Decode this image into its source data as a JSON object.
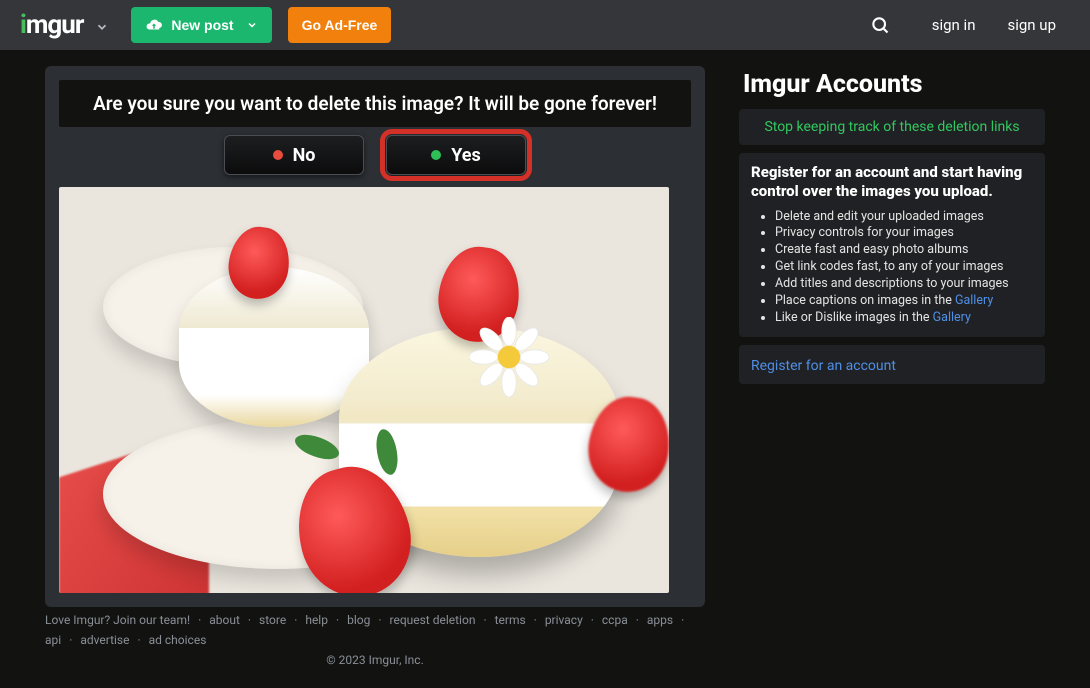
{
  "nav": {
    "logo_text": "imgur",
    "new_post": "New post",
    "ad_free": "Go Ad-Free",
    "signin": "sign in",
    "signup": "sign up"
  },
  "confirm": {
    "message": "Are you sure you want to delete this image? It will be gone forever!",
    "no": "No",
    "yes": "Yes"
  },
  "sidebar": {
    "title": "Imgur Accounts",
    "stop_link": "Stop keeping track of these deletion links",
    "register_heading": "Register for an account and start having control over the images you upload.",
    "bullets": [
      "Delete and edit your uploaded images",
      "Privacy controls for your images",
      "Create fast and easy photo albums",
      "Get link codes fast, to any of your images",
      "Add titles and descriptions to your images",
      "Place captions on images in the ",
      "Like or Dislike images in the "
    ],
    "gallery_word": "Gallery",
    "register_cta": "Register for an account"
  },
  "footer": {
    "join": "Love Imgur? Join our team!",
    "links": [
      "about",
      "store",
      "help",
      "blog",
      "request deletion",
      "terms",
      "privacy",
      "ccpa",
      "apps",
      "api",
      "advertise",
      "ad choices"
    ],
    "copyright": "© 2023 Imgur, Inc."
  }
}
